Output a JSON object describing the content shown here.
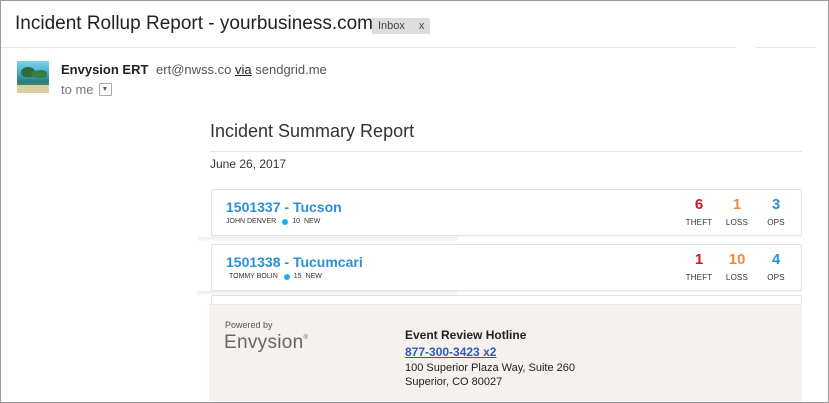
{
  "email": {
    "subject": "Incident Rollup Report - yourbusiness.com",
    "label": "Inbox",
    "label_close": "x",
    "sender": {
      "name": "Envysion ERT",
      "address": "ert@nwss.co",
      "via_label": "via",
      "via_domain": "sendgrid.me"
    },
    "recipient_label": "to me"
  },
  "report": {
    "title": "Incident Summary Report",
    "date": "June 26, 2017",
    "stat_labels": {
      "theft": "THEFT",
      "loss": "LOSS",
      "ops": "OPS"
    },
    "colors": {
      "theft": "#d0142c",
      "loss": "#f08a3c",
      "ops": "#2b8fd6",
      "link": "#2b8fd6",
      "new_dot": "#1bb0e9"
    },
    "incidents": [
      {
        "title": "1501337 - Tucson",
        "person": "JOHN DENVER",
        "new_count": "10",
        "new_label": "NEW",
        "theft": "6",
        "loss": "1",
        "ops": "3"
      },
      {
        "title": "1501338 - Tucumcari",
        "person": "TOMMY BOLIN",
        "new_count": "15",
        "new_label": "NEW",
        "theft": "1",
        "loss": "10",
        "ops": "4"
      }
    ]
  },
  "footer": {
    "powered_by": "Powered by",
    "brand": "Envysion",
    "brand_mark": "®",
    "hotline_title": "Event Review Hotline",
    "phone": "877-300-3423 x2",
    "address_line1": "100 Superior Plaza Way, Suite 260",
    "address_line2": "Superior, CO 80027"
  }
}
